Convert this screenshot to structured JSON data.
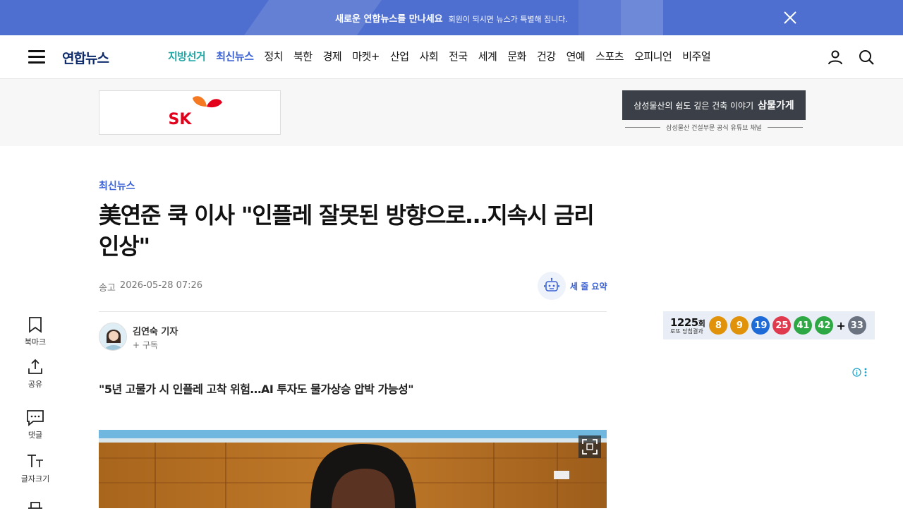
{
  "promo": {
    "title": "새로운 연합뉴스를 만나세요",
    "subtitle": "회원이 되시면 뉴스가 특별해 집니다.",
    "color": "#4f6fd0"
  },
  "header": {
    "logo": "연합뉴스",
    "nav": [
      {
        "label": "지방선거",
        "style": "teal"
      },
      {
        "label": "최신뉴스",
        "style": "blue"
      },
      {
        "label": "정치",
        "style": ""
      },
      {
        "label": "북한",
        "style": ""
      },
      {
        "label": "경제",
        "style": ""
      },
      {
        "label": "마켓+",
        "style": ""
      },
      {
        "label": "산업",
        "style": ""
      },
      {
        "label": "사회",
        "style": ""
      },
      {
        "label": "전국",
        "style": ""
      },
      {
        "label": "세계",
        "style": ""
      },
      {
        "label": "문화",
        "style": ""
      },
      {
        "label": "건강",
        "style": ""
      },
      {
        "label": "연예",
        "style": ""
      },
      {
        "label": "스포츠",
        "style": ""
      },
      {
        "label": "오피니언",
        "style": ""
      },
      {
        "label": "비주얼",
        "style": ""
      }
    ]
  },
  "ads": {
    "left_brand": "SK",
    "right_title_prefix": "삼성물산의 쉽도 깊은 건축 이야기",
    "right_title_bold": "삼물가게",
    "right_caption": "삼성물산 건설부문 공식 유튜브 채널"
  },
  "article": {
    "category": "최신뉴스",
    "headline": "美연준 쿡 이사 \"인플레 잘못된 방향으로…지속시 금리인상\"",
    "date_label": "송고",
    "date": "2026-05-28 07:26",
    "summary_label": "세 줄 요약",
    "reporter": "김연숙 기자",
    "subscribe": "+ 구독",
    "subheadline": "\"5년 고물가 시 인플레 고착 위험…AI 투자도 물가상승 압박 가능성\""
  },
  "tools": [
    {
      "icon": "bookmark-icon",
      "label": "북마크"
    },
    {
      "icon": "share-icon",
      "label": "공유"
    },
    {
      "icon": "comment-icon",
      "label": "댓글"
    },
    {
      "icon": "font-size-icon",
      "label": "글자크기"
    }
  ],
  "lotto": {
    "round": "1225",
    "round_suffix": "회",
    "caption": "로또 당첨결과",
    "numbers": [
      {
        "n": "8",
        "color": "#e0930a"
      },
      {
        "n": "9",
        "color": "#e0930a"
      },
      {
        "n": "19",
        "color": "#1e6ad6"
      },
      {
        "n": "25",
        "color": "#e03a4e"
      },
      {
        "n": "41",
        "color": "#2ea844"
      },
      {
        "n": "42",
        "color": "#2ea844"
      }
    ],
    "plus": "+",
    "bonus": {
      "n": "33",
      "color": "#6b7280"
    }
  }
}
